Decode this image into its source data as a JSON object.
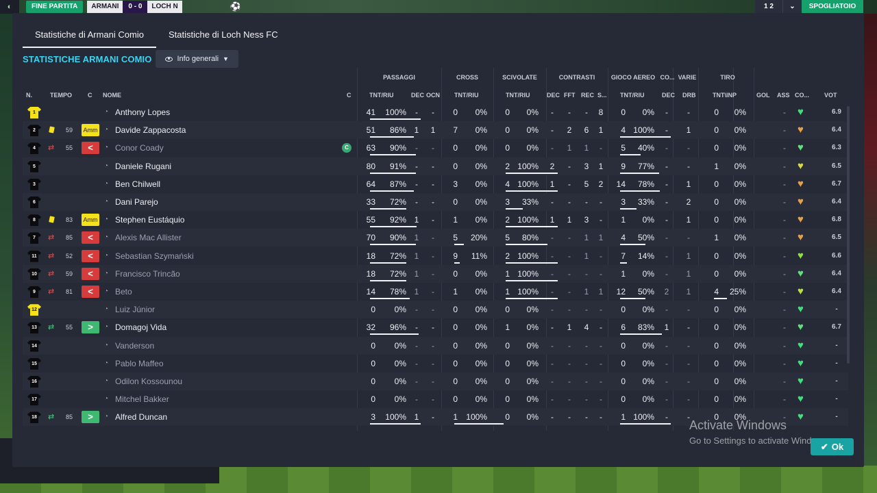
{
  "top_bar": {
    "phase": "FINE PARTITA",
    "home_team": "ARMANI",
    "score": "0 - 0",
    "away_team": "LOCH N",
    "counter": "1 2",
    "continue_label": "SPOGLIATOIO"
  },
  "tabs": [
    "Statistiche di Armani Comio",
    "Statistiche di Loch Ness FC"
  ],
  "section_title": "STATISTICHE ARMANI COMIO",
  "view_selector": "Info generali",
  "group_headers": {
    "passaggi": "PASSAGGI",
    "cross": "CROSS",
    "scivolate": "SCIVOLATE",
    "contrasti": "CONTRASTI",
    "gioco_aereo": "GIOCO AEREO",
    "co": "CO...",
    "varie": "VARIE",
    "tiro": "TIRO"
  },
  "columns": {
    "n": "N.",
    "tempo": "TEMPO",
    "c": "C",
    "nome": "NOME",
    "c2": "C",
    "pass_tnt": "TNT/RIU",
    "pass_dec": "DEC",
    "pass_ocn": "OCN",
    "cross_tnt": "TNT/RIU",
    "sciv_tnt": "TNT/RIU",
    "contr_dec": "DEC",
    "contr_fft": "FFT",
    "contr_rec": "REC",
    "contr_s": "S...",
    "aereo_tnt": "TNT/RIU",
    "co_dec": "DEC",
    "drb": "DRB",
    "tiro_tnt": "TNT\\INP",
    "gol": "GOL",
    "ass": "ASS",
    "co": "CO...",
    "vot": "VOT"
  },
  "players": [
    {
      "n": "1",
      "gk": true,
      "card": false,
      "min": "",
      "badge": "",
      "name": "Anthony Lopes",
      "dim": false,
      "cap": false,
      "pt": "41",
      "pp": "100%",
      "pdec": "-",
      "pocn": "-",
      "ct": "0",
      "cp": "0%",
      "st": "0",
      "sp": "0%",
      "cdec": "-",
      "cfft": "-",
      "crec": "-",
      "cs": "8",
      "at": "0",
      "ap": "0%",
      "codec": "-",
      "drb": "-",
      "tt": "0",
      "tp": "0%",
      "gol": "",
      "ass": "-",
      "heart": "#3ee07a",
      "vot": "6.9",
      "pf": 1.0,
      "sf": 0,
      "af": 0,
      "tf": 0,
      "cf": 0
    },
    {
      "n": "2",
      "gk": false,
      "card": true,
      "min": "59",
      "badge": "amm",
      "name": "Davide Zappacosta",
      "dim": false,
      "cap": false,
      "pt": "51",
      "pp": "86%",
      "pdec": "1",
      "pocn": "1",
      "ct": "7",
      "cp": "0%",
      "st": "0",
      "sp": "0%",
      "cdec": "-",
      "cfft": "2",
      "crec": "6",
      "cs": "1",
      "at": "4",
      "ap": "100%",
      "codec": "-",
      "drb": "1",
      "tt": "0",
      "tp": "0%",
      "gol": "",
      "ass": "-",
      "heart": "#e9a045",
      "vot": "6.4",
      "pf": 0.86,
      "sf": 0,
      "af": 1.0,
      "tf": 0,
      "cf": 0
    },
    {
      "n": "4",
      "gk": false,
      "card": false,
      "min": "55",
      "badge": "off",
      "name": "Conor Coady",
      "dim": true,
      "cap": true,
      "pt": "63",
      "pp": "90%",
      "pdec": "-",
      "pocn": "-",
      "ct": "0",
      "cp": "0%",
      "st": "0",
      "sp": "0%",
      "cdec": "-",
      "cfft": "1",
      "crec": "1",
      "cs": "-",
      "at": "5",
      "ap": "40%",
      "codec": "-",
      "drb": "-",
      "tt": "0",
      "tp": "0%",
      "gol": "",
      "ass": "-",
      "heart": "#5ee07a",
      "vot": "6.3",
      "pf": 0.9,
      "sf": 0,
      "af": 0.4,
      "tf": 0,
      "cf": 0
    },
    {
      "n": "5",
      "gk": false,
      "card": false,
      "min": "",
      "badge": "",
      "name": "Daniele Rugani",
      "dim": false,
      "cap": false,
      "pt": "80",
      "pp": "91%",
      "pdec": "-",
      "pocn": "-",
      "ct": "0",
      "cp": "0%",
      "st": "2",
      "sp": "100%",
      "cdec": "2",
      "cfft": "-",
      "crec": "3",
      "cs": "1",
      "at": "9",
      "ap": "77%",
      "codec": "-",
      "drb": "-",
      "tt": "1",
      "tp": "0%",
      "gol": "",
      "ass": "-",
      "heart": "#d8d840",
      "vot": "6.5",
      "pf": 0.91,
      "sf": 1.0,
      "af": 0.77,
      "tf": 0,
      "cf": 0
    },
    {
      "n": "3",
      "gk": false,
      "card": false,
      "min": "",
      "badge": "",
      "name": "Ben Chilwell",
      "dim": false,
      "cap": false,
      "pt": "64",
      "pp": "87%",
      "pdec": "-",
      "pocn": "-",
      "ct": "3",
      "cp": "0%",
      "st": "4",
      "sp": "100%",
      "cdec": "1",
      "cfft": "-",
      "crec": "5",
      "cs": "2",
      "at": "14",
      "ap": "78%",
      "codec": "-",
      "drb": "1",
      "tt": "0",
      "tp": "0%",
      "gol": "",
      "ass": "-",
      "heart": "#e9a045",
      "vot": "6.7",
      "pf": 0.87,
      "sf": 1.0,
      "af": 0.78,
      "tf": 0,
      "cf": 0
    },
    {
      "n": "6",
      "gk": false,
      "card": false,
      "min": "",
      "badge": "",
      "name": "Dani Parejo",
      "dim": false,
      "cap": false,
      "pt": "33",
      "pp": "72%",
      "pdec": "-",
      "pocn": "-",
      "ct": "0",
      "cp": "0%",
      "st": "3",
      "sp": "33%",
      "cdec": "-",
      "cfft": "-",
      "crec": "-",
      "cs": "-",
      "at": "3",
      "ap": "33%",
      "codec": "-",
      "drb": "2",
      "tt": "0",
      "tp": "0%",
      "gol": "",
      "ass": "-",
      "heart": "#e9a045",
      "vot": "6.4",
      "pf": 0.72,
      "sf": 0.33,
      "af": 0.33,
      "tf": 0,
      "cf": 0
    },
    {
      "n": "8",
      "gk": false,
      "card": true,
      "min": "83",
      "badge": "amm",
      "name": "Stephen Eustáquio",
      "dim": false,
      "cap": false,
      "pt": "55",
      "pp": "92%",
      "pdec": "1",
      "pocn": "-",
      "ct": "1",
      "cp": "0%",
      "st": "2",
      "sp": "100%",
      "cdec": "1",
      "cfft": "1",
      "crec": "3",
      "cs": "-",
      "at": "1",
      "ap": "0%",
      "codec": "-",
      "drb": "1",
      "tt": "0",
      "tp": "0%",
      "gol": "",
      "ass": "-",
      "heart": "#e9a045",
      "vot": "6.8",
      "pf": 0.92,
      "sf": 1.0,
      "af": 0,
      "tf": 0,
      "cf": 0
    },
    {
      "n": "7",
      "gk": false,
      "card": false,
      "min": "85",
      "badge": "off",
      "name": "Alexis Mac Allister",
      "dim": true,
      "cap": false,
      "pt": "70",
      "pp": "90%",
      "pdec": "1",
      "pocn": "-",
      "ct": "5",
      "cp": "20%",
      "st": "5",
      "sp": "80%",
      "cdec": "-",
      "cfft": "-",
      "crec": "1",
      "cs": "1",
      "at": "4",
      "ap": "50%",
      "codec": "-",
      "drb": "-",
      "tt": "1",
      "tp": "0%",
      "gol": "",
      "ass": "-",
      "heart": "#e9a045",
      "vot": "6.5",
      "pf": 0.9,
      "sf": 0.8,
      "af": 0.5,
      "tf": 0,
      "cf": 0.2
    },
    {
      "n": "11",
      "gk": false,
      "card": false,
      "min": "52",
      "badge": "off",
      "name": "Sebastian Szymański",
      "dim": true,
      "cap": false,
      "pt": "18",
      "pp": "72%",
      "pdec": "1",
      "pocn": "-",
      "ct": "9",
      "cp": "11%",
      "st": "2",
      "sp": "100%",
      "cdec": "-",
      "cfft": "-",
      "crec": "1",
      "cs": "-",
      "at": "7",
      "ap": "14%",
      "codec": "-",
      "drb": "1",
      "tt": "0",
      "tp": "0%",
      "gol": "",
      "ass": "-",
      "heart": "#8ee040",
      "vot": "6.6",
      "pf": 0.72,
      "sf": 1.0,
      "af": 0.14,
      "tf": 0,
      "cf": 0.11
    },
    {
      "n": "10",
      "gk": false,
      "card": false,
      "min": "59",
      "badge": "off",
      "name": "Francisco Trincão",
      "dim": true,
      "cap": false,
      "pt": "18",
      "pp": "72%",
      "pdec": "1",
      "pocn": "-",
      "ct": "0",
      "cp": "0%",
      "st": "1",
      "sp": "100%",
      "cdec": "-",
      "cfft": "-",
      "crec": "-",
      "cs": "-",
      "at": "1",
      "ap": "0%",
      "codec": "-",
      "drb": "1",
      "tt": "0",
      "tp": "0%",
      "gol": "",
      "ass": "-",
      "heart": "#5ee07a",
      "vot": "6.4",
      "pf": 0.72,
      "sf": 1.0,
      "af": 0,
      "tf": 0,
      "cf": 0
    },
    {
      "n": "9",
      "gk": false,
      "card": false,
      "min": "81",
      "badge": "off",
      "name": "Beto",
      "dim": true,
      "cap": false,
      "pt": "14",
      "pp": "78%",
      "pdec": "1",
      "pocn": "-",
      "ct": "1",
      "cp": "0%",
      "st": "1",
      "sp": "100%",
      "cdec": "-",
      "cfft": "-",
      "crec": "1",
      "cs": "1",
      "at": "12",
      "ap": "50%",
      "codec": "2",
      "drb": "1",
      "tt": "4",
      "tp": "25%",
      "gol": "",
      "ass": "-",
      "heart": "#b8e040",
      "vot": "6.4",
      "pf": 0.78,
      "sf": 1.0,
      "af": 0.5,
      "tf": 0.25,
      "cf": 0
    },
    {
      "n": "12",
      "gk": true,
      "card": false,
      "min": "",
      "badge": "",
      "name": "Luiz Júnior",
      "dim": true,
      "cap": false,
      "pt": "0",
      "pp": "0%",
      "pdec": "-",
      "pocn": "-",
      "ct": "0",
      "cp": "0%",
      "st": "0",
      "sp": "0%",
      "cdec": "-",
      "cfft": "-",
      "crec": "-",
      "cs": "-",
      "at": "0",
      "ap": "0%",
      "codec": "-",
      "drb": "-",
      "tt": "0",
      "tp": "0%",
      "gol": "",
      "ass": "-",
      "heart": "#3ee07a",
      "vot": "-",
      "pf": 0,
      "sf": 0,
      "af": 0,
      "tf": 0,
      "cf": 0
    },
    {
      "n": "13",
      "gk": false,
      "card": false,
      "min": "55",
      "badge": "on",
      "name": "Domagoj Vida",
      "dim": false,
      "cap": false,
      "pt": "32",
      "pp": "96%",
      "pdec": "-",
      "pocn": "-",
      "ct": "0",
      "cp": "0%",
      "st": "1",
      "sp": "0%",
      "cdec": "-",
      "cfft": "1",
      "crec": "4",
      "cs": "-",
      "at": "6",
      "ap": "83%",
      "codec": "1",
      "drb": "-",
      "tt": "0",
      "tp": "0%",
      "gol": "",
      "ass": "-",
      "heart": "#5ee07a",
      "vot": "6.7",
      "pf": 0.96,
      "sf": 0,
      "af": 0.83,
      "tf": 0,
      "cf": 0
    },
    {
      "n": "14",
      "gk": false,
      "card": false,
      "min": "",
      "badge": "",
      "name": "Vanderson",
      "dim": true,
      "cap": false,
      "pt": "0",
      "pp": "0%",
      "pdec": "-",
      "pocn": "-",
      "ct": "0",
      "cp": "0%",
      "st": "0",
      "sp": "0%",
      "cdec": "-",
      "cfft": "-",
      "crec": "-",
      "cs": "-",
      "at": "0",
      "ap": "0%",
      "codec": "-",
      "drb": "-",
      "tt": "0",
      "tp": "0%",
      "gol": "",
      "ass": "-",
      "heart": "#3ee07a",
      "vot": "-",
      "pf": 0,
      "sf": 0,
      "af": 0,
      "tf": 0,
      "cf": 0
    },
    {
      "n": "15",
      "gk": false,
      "card": false,
      "min": "",
      "badge": "",
      "name": "Pablo Maffeo",
      "dim": true,
      "cap": false,
      "pt": "0",
      "pp": "0%",
      "pdec": "-",
      "pocn": "-",
      "ct": "0",
      "cp": "0%",
      "st": "0",
      "sp": "0%",
      "cdec": "-",
      "cfft": "-",
      "crec": "-",
      "cs": "-",
      "at": "0",
      "ap": "0%",
      "codec": "-",
      "drb": "-",
      "tt": "0",
      "tp": "0%",
      "gol": "",
      "ass": "-",
      "heart": "#3ee07a",
      "vot": "-",
      "pf": 0,
      "sf": 0,
      "af": 0,
      "tf": 0,
      "cf": 0
    },
    {
      "n": "16",
      "gk": false,
      "card": false,
      "min": "",
      "badge": "",
      "name": "Odilon Kossounou",
      "dim": true,
      "cap": false,
      "pt": "0",
      "pp": "0%",
      "pdec": "-",
      "pocn": "-",
      "ct": "0",
      "cp": "0%",
      "st": "0",
      "sp": "0%",
      "cdec": "-",
      "cfft": "-",
      "crec": "-",
      "cs": "-",
      "at": "0",
      "ap": "0%",
      "codec": "-",
      "drb": "-",
      "tt": "0",
      "tp": "0%",
      "gol": "",
      "ass": "-",
      "heart": "#3ee07a",
      "vot": "-",
      "pf": 0,
      "sf": 0,
      "af": 0,
      "tf": 0,
      "cf": 0
    },
    {
      "n": "17",
      "gk": false,
      "card": false,
      "min": "",
      "badge": "",
      "name": "Mitchel Bakker",
      "dim": true,
      "cap": false,
      "pt": "0",
      "pp": "0%",
      "pdec": "-",
      "pocn": "-",
      "ct": "0",
      "cp": "0%",
      "st": "0",
      "sp": "0%",
      "cdec": "-",
      "cfft": "-",
      "crec": "-",
      "cs": "-",
      "at": "0",
      "ap": "0%",
      "codec": "-",
      "drb": "-",
      "tt": "0",
      "tp": "0%",
      "gol": "",
      "ass": "-",
      "heart": "#3ee07a",
      "vot": "-",
      "pf": 0,
      "sf": 0,
      "af": 0,
      "tf": 0,
      "cf": 0
    },
    {
      "n": "18",
      "gk": false,
      "card": false,
      "min": "85",
      "badge": "on",
      "name": "Alfred Duncan",
      "dim": false,
      "cap": false,
      "pt": "3",
      "pp": "100%",
      "pdec": "1",
      "pocn": "-",
      "ct": "1",
      "cp": "100%",
      "st": "0",
      "sp": "0%",
      "cdec": "-",
      "cfft": "-",
      "crec": "-",
      "cs": "-",
      "at": "1",
      "ap": "100%",
      "codec": "-",
      "drb": "-",
      "tt": "0",
      "tp": "0%",
      "gol": "",
      "ass": "-",
      "heart": "#3ee07a",
      "vot": "-",
      "pf": 1.0,
      "sf": 0,
      "af": 1.0,
      "tf": 0,
      "cf": 1.0
    }
  ],
  "badges": {
    "amm": "Amm",
    "off": "<",
    "on": ">"
  },
  "captain_letter": "C",
  "watermark": {
    "line1": "Activate Windows",
    "line2": "Go to Settings to activate Windows."
  },
  "ok_label": "Ok",
  "colors": {
    "accent": "#3ad3f0",
    "ok": "#19a3a3",
    "yellow_card": "#f5e21a",
    "sub_off": "#d63c3c",
    "sub_on": "#3fb872"
  }
}
